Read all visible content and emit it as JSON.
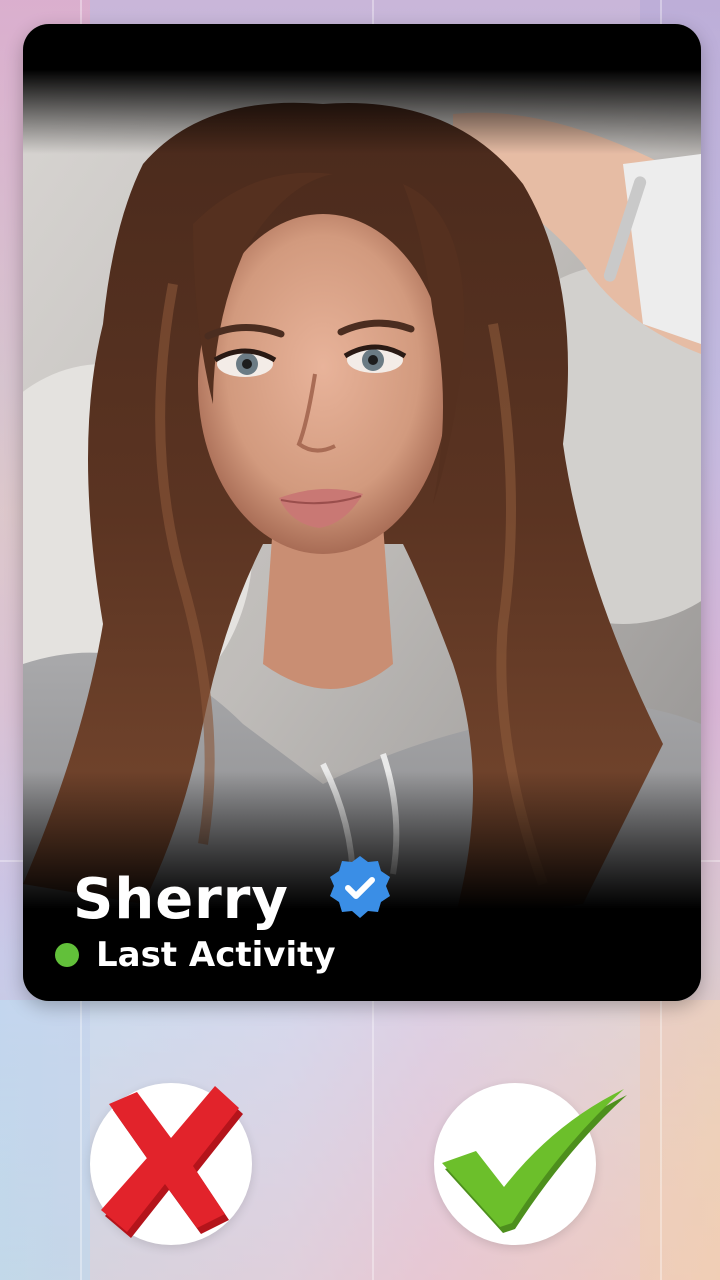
{
  "profile": {
    "name": "Sherry",
    "status_text": "Last Activity",
    "verified_icon": "verified-badge-icon",
    "online_color": "#62c03a",
    "verified_color": "#3a8ee6"
  },
  "actions": {
    "reject_icon": "red-x-icon",
    "accept_icon": "green-check-icon",
    "reject_color": "#e2232b",
    "accept_color": "#6cbf2b"
  }
}
